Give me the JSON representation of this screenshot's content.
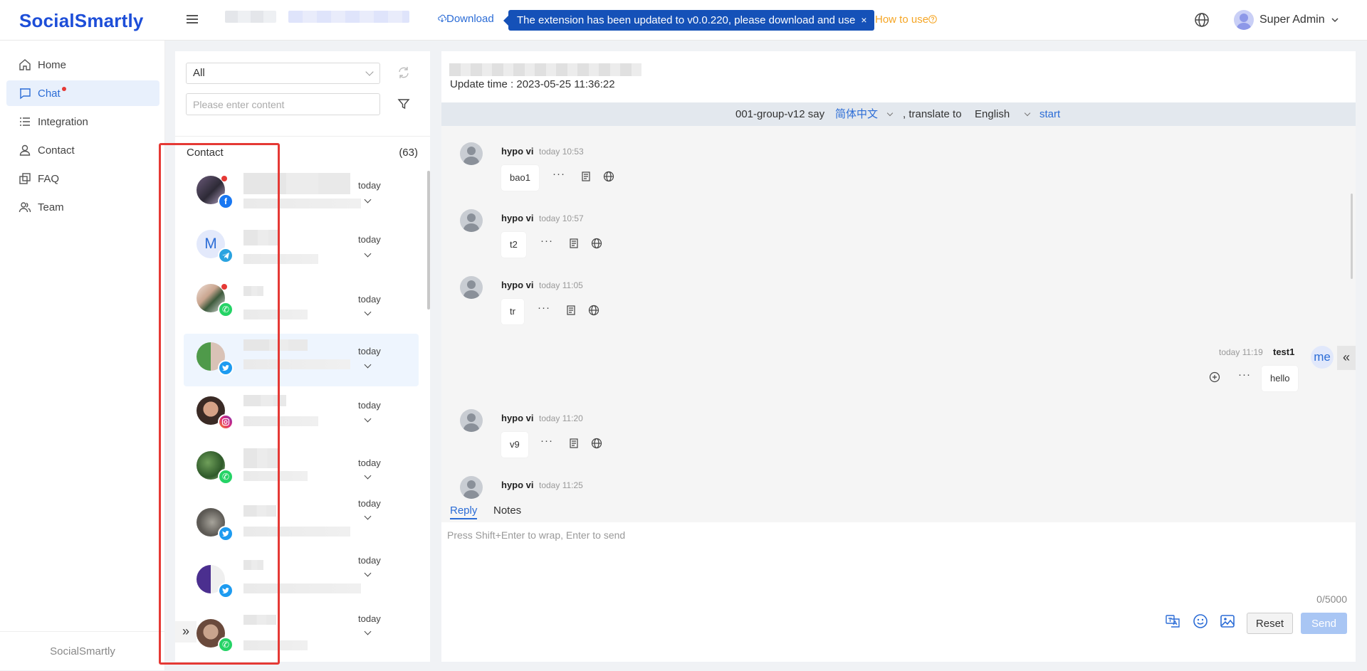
{
  "header": {
    "logo": "SocialSmartly",
    "download_label": "Download",
    "notice_text": "The extension has been updated to v0.0.220, please download and use",
    "notice_close": "×",
    "how_to_label": "How to use",
    "user_name": "Super Admin"
  },
  "sidebar": {
    "items": [
      {
        "label": "Home",
        "icon": "home-icon"
      },
      {
        "label": "Chat",
        "icon": "chat-icon",
        "active": true,
        "unread": true
      },
      {
        "label": "Integration",
        "icon": "list-icon"
      },
      {
        "label": "Contact",
        "icon": "user-icon"
      },
      {
        "label": "FAQ",
        "icon": "faq-icon"
      },
      {
        "label": "Team",
        "icon": "team-icon"
      }
    ],
    "footer": "SocialSmartly"
  },
  "contacts_panel": {
    "filter_value": "All",
    "search_placeholder": "Please enter content",
    "title": "Contact",
    "count": "(63)",
    "rows": [
      {
        "time": "today",
        "platform": "facebook",
        "unread": true
      },
      {
        "time": "today",
        "platform": "telegram",
        "avatar_letter": "M"
      },
      {
        "time": "today",
        "platform": "whatsapp",
        "unread": true
      },
      {
        "time": "today",
        "platform": "twitter",
        "selected": true
      },
      {
        "time": "today",
        "platform": "instagram"
      },
      {
        "time": "today",
        "platform": "whatsapp"
      },
      {
        "time": "today",
        "platform": "twitter"
      },
      {
        "time": "today",
        "platform": "twitter"
      },
      {
        "time": "today",
        "platform": "whatsapp"
      }
    ],
    "expand_glyph": "»"
  },
  "chat": {
    "update_time": "Update time : 2023-05-25 11:36:22",
    "translate_bar": {
      "say_prefix": "001-group-v12 say",
      "source_lang": "简体中文",
      "translate_to": ", translate to",
      "target_lang": "English",
      "start": "start"
    },
    "messages": [
      {
        "sender": "hypo vi",
        "time": "today 10:53",
        "text": "bao1"
      },
      {
        "sender": "hypo vi",
        "time": "today 10:57",
        "text": "t2"
      },
      {
        "sender": "hypo vi",
        "time": "today 11:05",
        "text": "tr"
      },
      {
        "sender": "test1",
        "time": "today 11:19",
        "text": "hello",
        "outgoing": true
      },
      {
        "sender": "hypo vi",
        "time": "today 11:20",
        "text": "v9"
      },
      {
        "sender": "hypo vi",
        "time": "today 11:25",
        "text": ""
      }
    ],
    "me_label": "me",
    "more_glyph": "···",
    "collapse_glyph": "«",
    "tabs": [
      "Reply",
      "Notes"
    ],
    "composer_placeholder": "Press Shift+Enter to wrap, Enter to send",
    "char_count": "0/5000",
    "reset_label": "Reset",
    "send_label": "Send"
  },
  "colors": {
    "brand": "#1d4ed8",
    "accent": "#2b6cd6",
    "notice_bg": "#1551b8",
    "how_to": "#f5a524",
    "unread": "#e53935",
    "highlight_box": "#e53935"
  }
}
